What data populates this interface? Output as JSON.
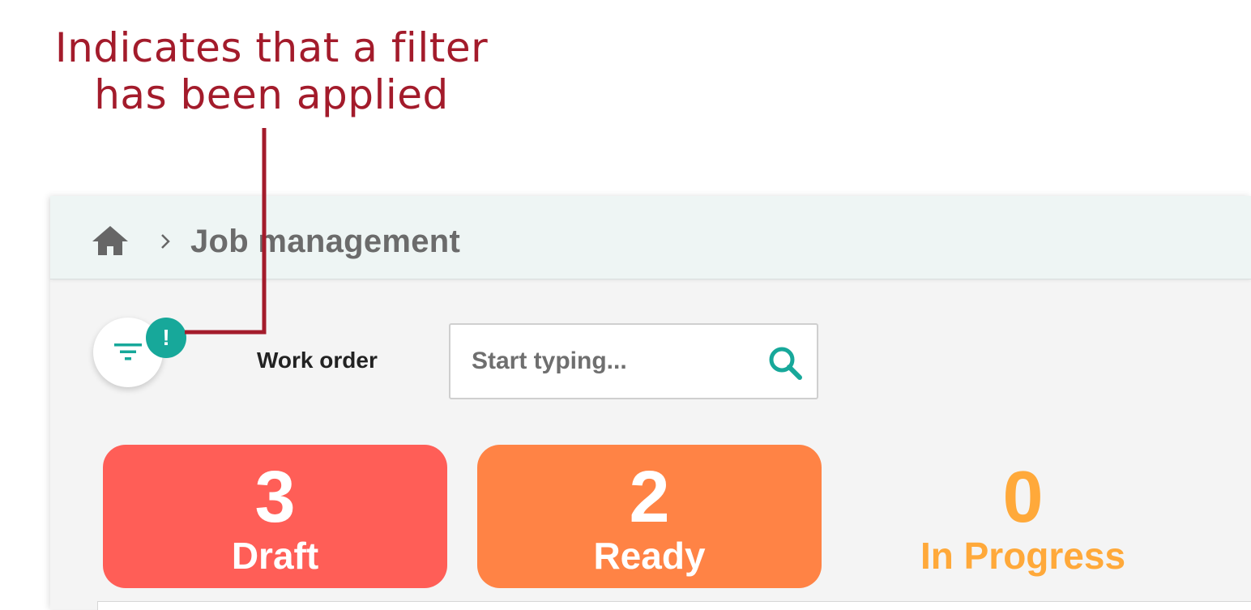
{
  "annotation": {
    "line1": "Indicates that a filter",
    "line2": "has been applied"
  },
  "breadcrumb": {
    "home_icon": "home-icon",
    "separator_icon": "chevron-right-icon",
    "current": "Job management"
  },
  "filter": {
    "icon": "filter-icon",
    "badge": "!"
  },
  "search": {
    "label": "Work order",
    "placeholder": "Start typing...",
    "value": "",
    "icon": "search-icon"
  },
  "status_cards": [
    {
      "count": "3",
      "label": "Draft",
      "color": "#ff5e57"
    },
    {
      "count": "2",
      "label": "Ready",
      "color": "#ff8345"
    },
    {
      "count": "0",
      "label": "In Progress",
      "color": "#ffa93a"
    }
  ],
  "colors": {
    "accent": "#17a89a",
    "annotation": "#a31b2b",
    "breadcrumb_bg": "#eef5f4",
    "panel_bg": "#f4f4f4"
  }
}
